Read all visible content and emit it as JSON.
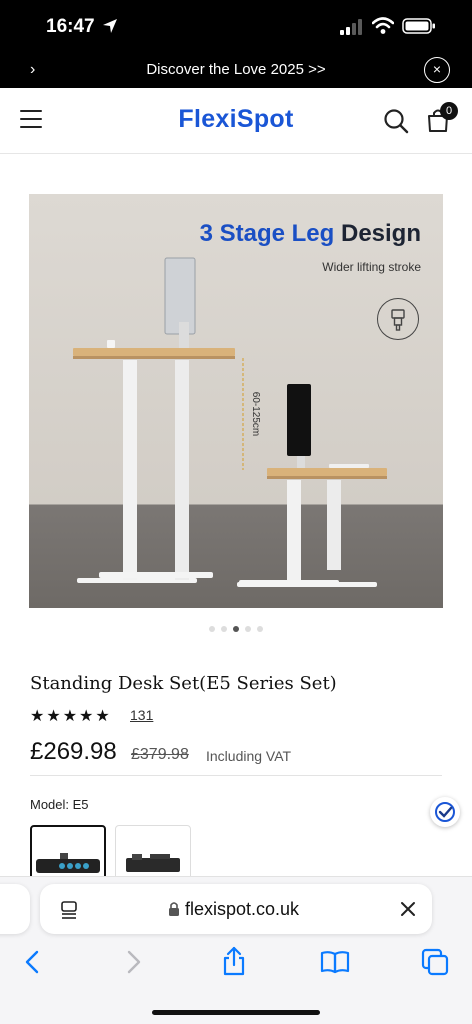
{
  "status_bar": {
    "time": "16:47",
    "icons": [
      "location-arrow-icon",
      "signal-icon",
      "wifi-icon",
      "battery-icon"
    ]
  },
  "announcement": {
    "text": "Discover the Love 2025 >>",
    "prev_glyph": "›",
    "close_glyph": "×"
  },
  "header": {
    "logo": "FlexiSpot",
    "cart_count": "0",
    "icons": [
      "menu-icon",
      "search-icon",
      "cart-icon"
    ]
  },
  "product_image": {
    "title_highlight": "3 Stage Leg",
    "title_rest": "Design",
    "subtitle": "Wider lifting stroke",
    "height_range": "60-125cm",
    "carousel_total": 5,
    "carousel_active": 3
  },
  "product": {
    "title": "Standing Desk Set(E5 Series Set)",
    "stars": "★★★★★",
    "rating_value": 5,
    "review_count": "131",
    "price": "£269.98",
    "old_price": "£379.98",
    "vat_label": "Including VAT",
    "model_label": "Model: E5"
  },
  "browser": {
    "url": "flexispot.co.uk",
    "icons": [
      "back-icon",
      "forward-icon",
      "share-icon",
      "bookmarks-icon",
      "tabs-icon"
    ]
  },
  "colors": {
    "brand_blue": "#1a56d6",
    "title_blue": "#1a4fc4",
    "ios_blue": "#0a7aff",
    "black_bar": "#000000"
  }
}
